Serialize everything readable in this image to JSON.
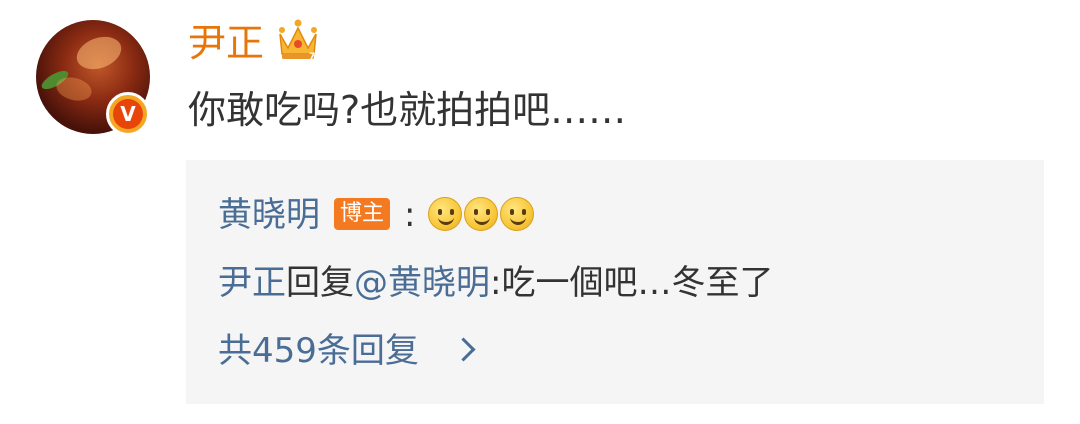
{
  "comment": {
    "username": "尹正",
    "text": "你敢吃吗?也就拍拍吧……",
    "avatar_badge": "V",
    "icons": [
      "avatar",
      "verified-v-icon",
      "crown-icon"
    ]
  },
  "replies": [
    {
      "author": "黄晓明",
      "host_badge": "博主",
      "colon": ":",
      "emojis": [
        "smile-emoji",
        "smile-emoji",
        "smile-emoji"
      ]
    },
    {
      "author": "尹正",
      "reply_word": "回复",
      "mention": "@黄晓明",
      "text": ":吃一個吧…冬至了"
    }
  ],
  "more_replies": {
    "label": "共459条回复",
    "icon": "chevron-right-icon"
  },
  "colors": {
    "username": "#e8750a",
    "link": "#4a6d95",
    "host_badge": "#f47a21",
    "reply_bg": "#f5f5f5",
    "text": "#333333"
  }
}
